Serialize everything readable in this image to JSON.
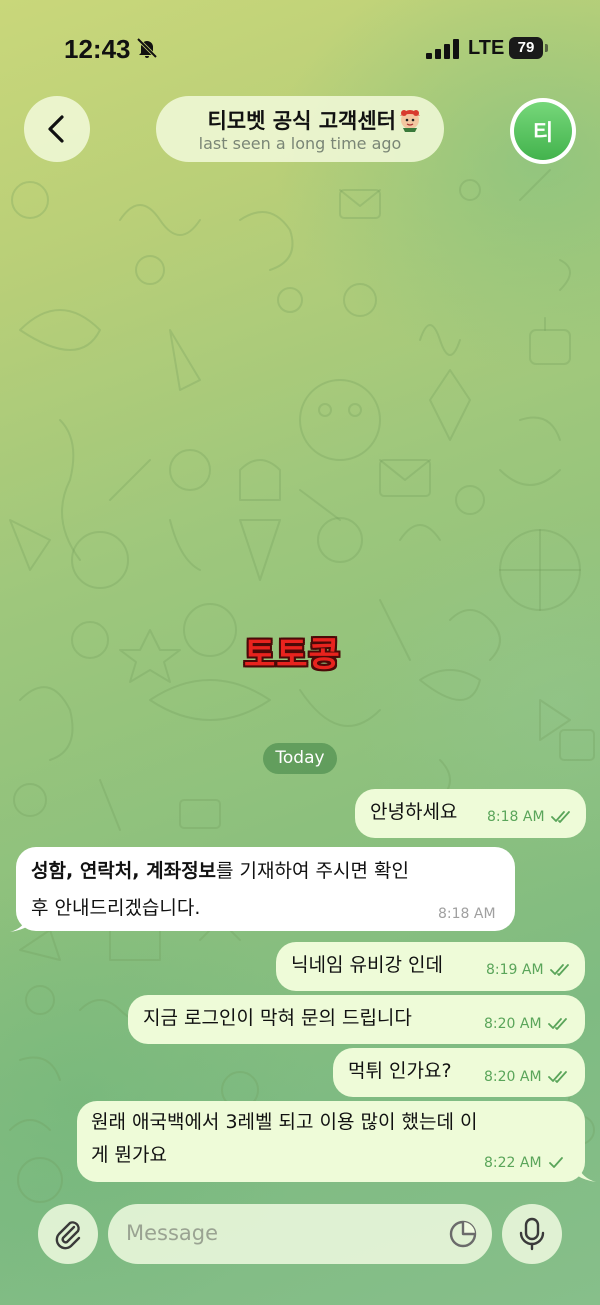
{
  "status_bar": {
    "time": "12:43",
    "network": "LTE",
    "battery": "79"
  },
  "header": {
    "back_icon": "chevron-left-icon",
    "title": "티모벳 공식 고객센터",
    "subtitle": "last seen a long time ago",
    "avatar_letter": "티"
  },
  "watermark": "토토콩",
  "date_label": "Today",
  "messages": [
    {
      "direction": "out",
      "text": "안녕하세요",
      "time": "8:18 AM",
      "status": "read"
    },
    {
      "direction": "in",
      "line1_bold_1": "성함",
      "line1_sep_1": ", ",
      "line1_bold_2": "연락처",
      "line1_sep_2": ", ",
      "line1_bold_3": "계좌정보",
      "line1_rest": "를 기재하여 주시면 확인",
      "line2": "후 안내드리겠습니다.",
      "time": "8:18 AM"
    },
    {
      "direction": "out",
      "text": "닉네임 유비강 인데",
      "time": "8:19 AM",
      "status": "read"
    },
    {
      "direction": "out",
      "text": "지금 로그인이 막혀 문의 드립니다",
      "time": "8:20 AM",
      "status": "read"
    },
    {
      "direction": "out",
      "text": "먹튀 인가요?",
      "time": "8:20 AM",
      "status": "read"
    },
    {
      "direction": "out",
      "line1": "원래 애국백에서 3레벨 되고 이용 많이 했는데 이",
      "line2": "게 뭔가요",
      "time": "8:22 AM",
      "status": "sent"
    }
  ],
  "input_bar": {
    "placeholder": "Message",
    "attach_icon": "paperclip-icon",
    "sticker_icon": "sticker-icon",
    "mic_icon": "microphone-icon"
  },
  "colors": {
    "outgoing_bubble": "#eefbd8",
    "incoming_bubble": "#ffffff",
    "check_color": "#5aa55a",
    "avatar_green": "#4cbc55"
  }
}
